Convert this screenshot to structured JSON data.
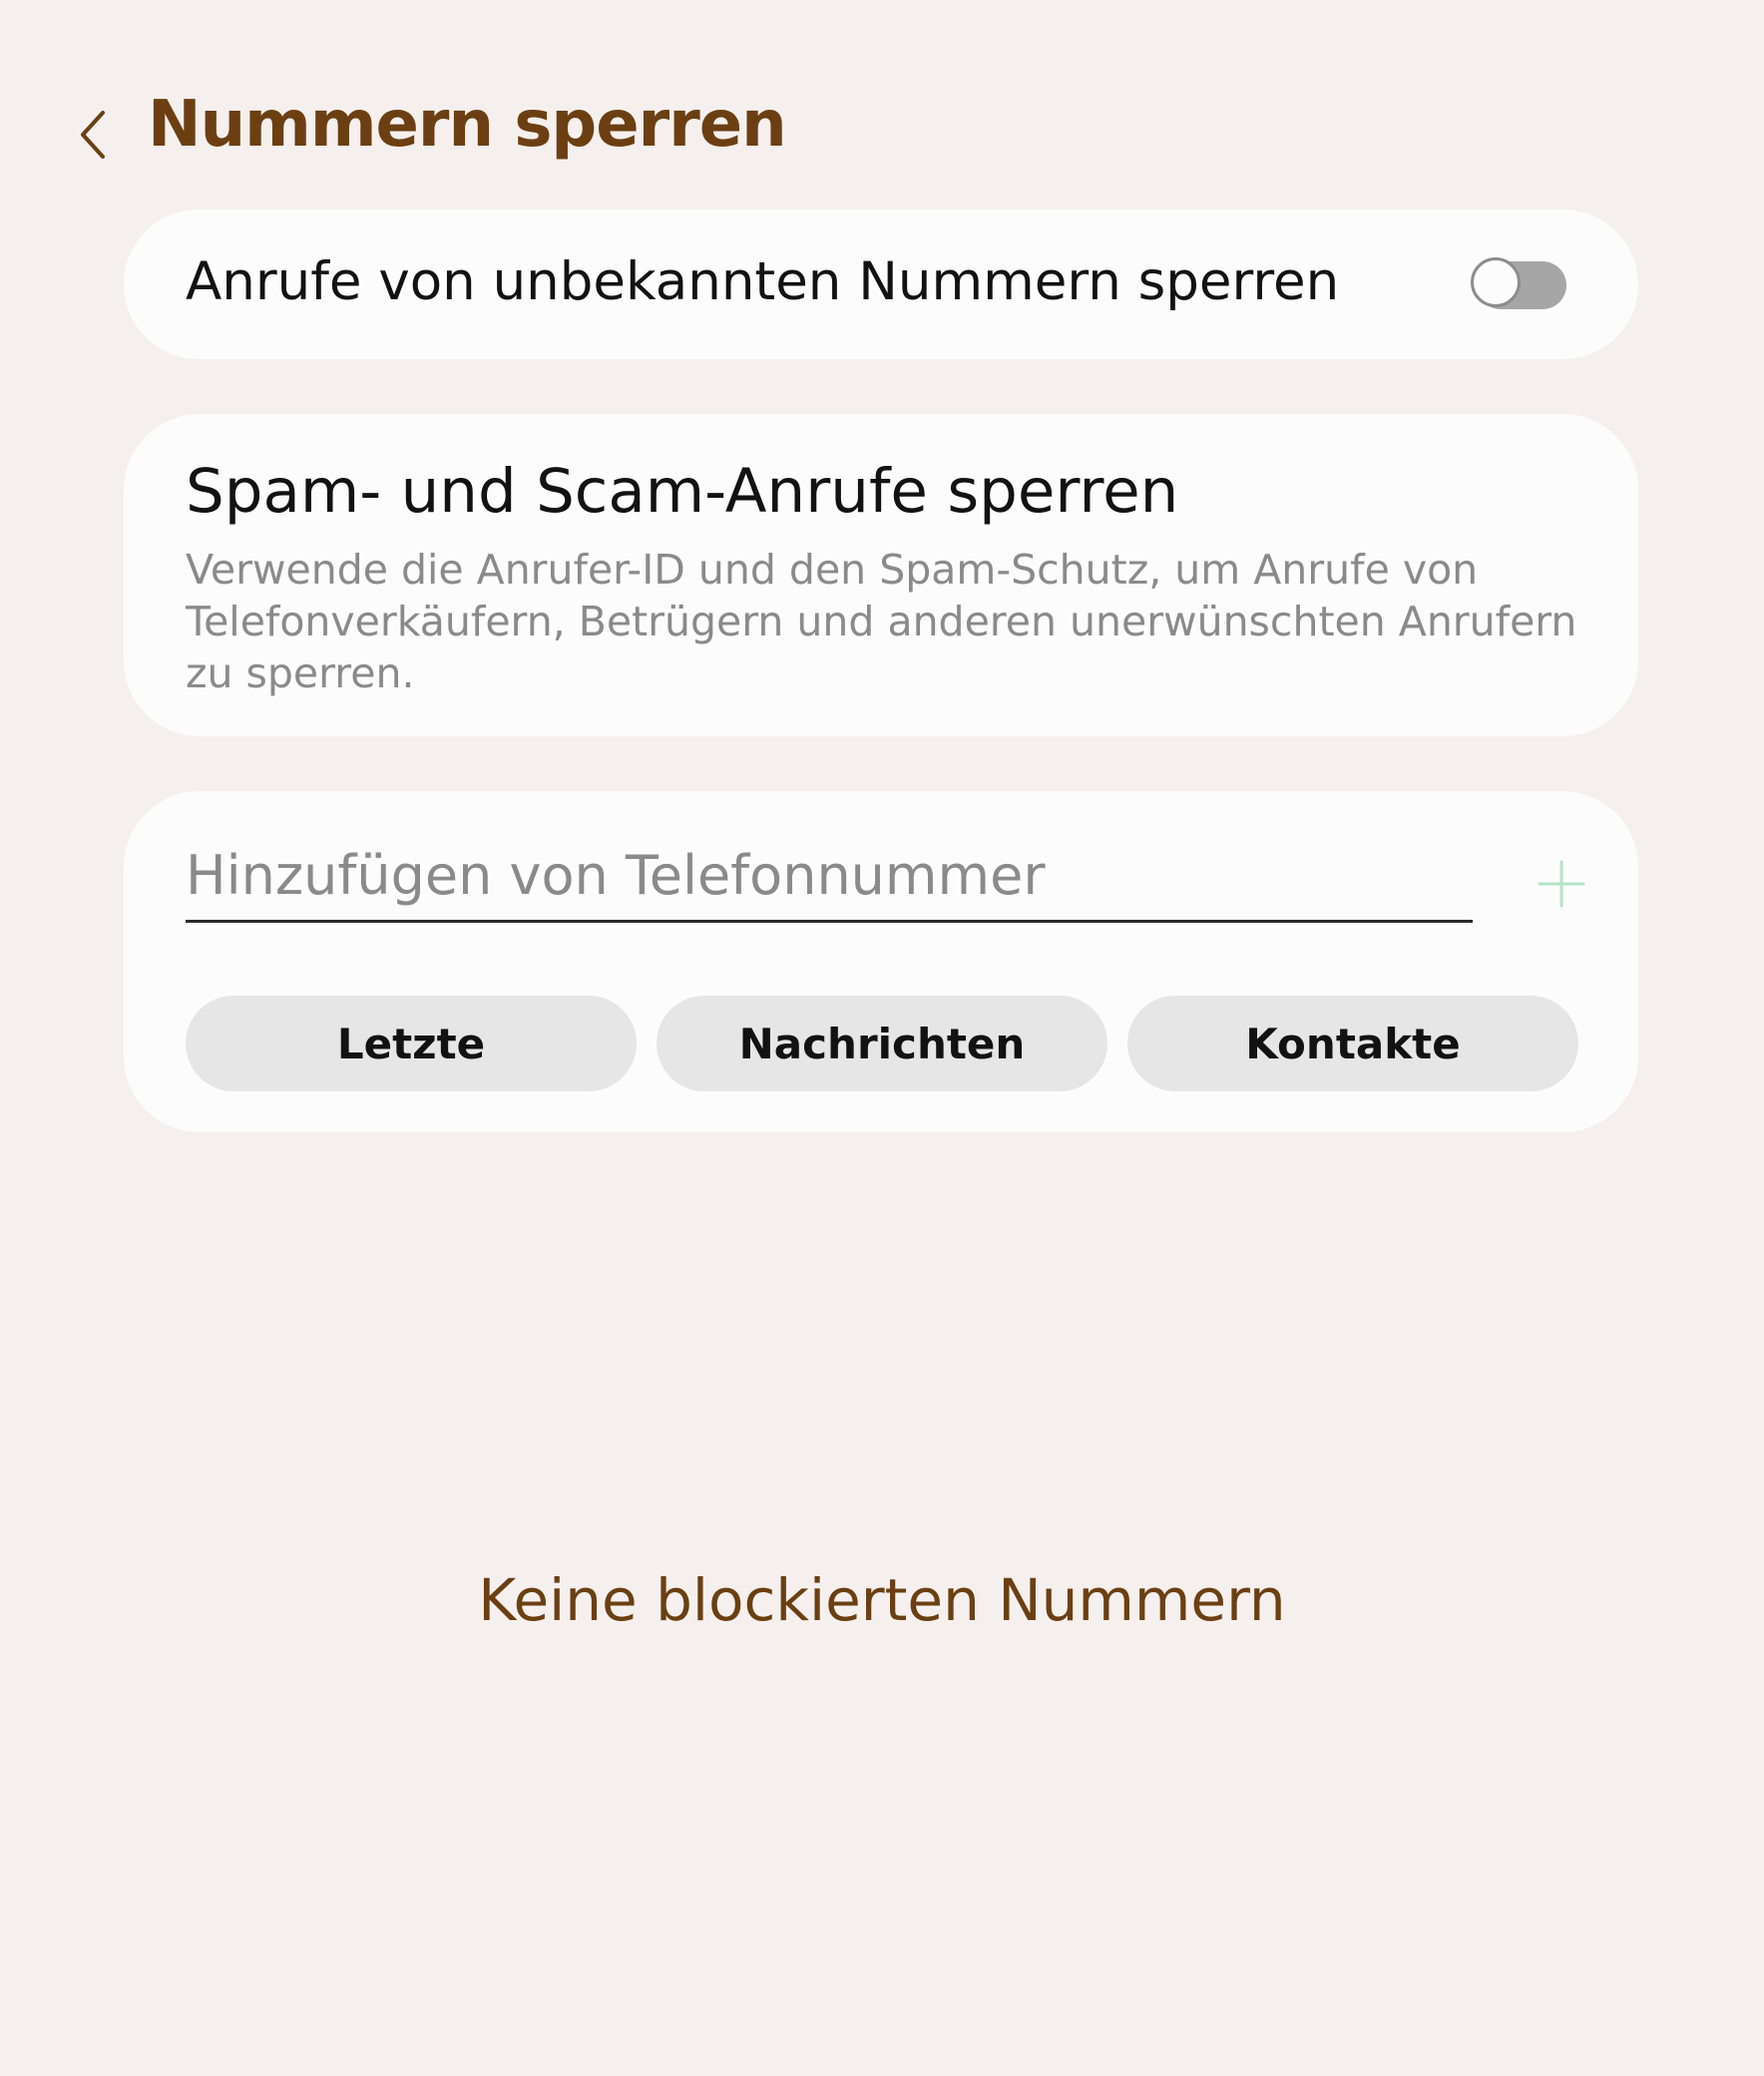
{
  "header": {
    "title": "Nummern sperren",
    "back_icon": "chevron-left-icon"
  },
  "unknown_numbers": {
    "label": "Anrufe von unbekannten Nummern sperren",
    "enabled": false
  },
  "spam": {
    "title": "Spam- und Scam-Anrufe sperren",
    "description": "Verwende die Anrufer-ID und den Spam-Schutz, um Anrufe von Telefonverkäufern, Betrügern und anderen unerwünschten Anrufern zu sperren."
  },
  "add_number": {
    "placeholder": "Hinzufügen von Telefonnummer",
    "value": "",
    "add_icon": "plus-icon",
    "chips": [
      {
        "label": "Letzte"
      },
      {
        "label": "Nachrichten"
      },
      {
        "label": "Kontakte"
      }
    ]
  },
  "empty_state": {
    "message": "Keine blockierten Nummern"
  },
  "colors": {
    "accent": "#6b3f12",
    "background": "#f5f0ee",
    "card": "#fcfcfc",
    "chip": "#e6e6e6",
    "add_icon": "#b3e3c6"
  }
}
